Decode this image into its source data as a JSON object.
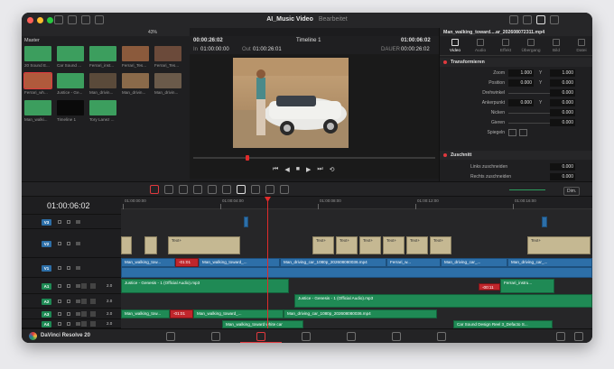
{
  "window": {
    "title": "AI_Music Video",
    "subtitle": "Bearbeitet"
  },
  "colors": {
    "close": "#ff5f57",
    "minimize": "#febc2e",
    "maximize": "#28c840",
    "playhead": "#e02b2b",
    "video_clip": "#2d6fa8",
    "title_clip": "#c5b892",
    "audio_clip": "#1f8a55",
    "red_marker": "#c0262c"
  },
  "media_pool": {
    "header": "Master",
    "zoom": "43%",
    "items": [
      {
        "label": "20 Sound E...",
        "color": "#3c9e5e"
      },
      {
        "label": "Car Sound ...",
        "color": "#3c9e5e"
      },
      {
        "label": "Ferrari_inst...",
        "color": "#3c9e5e"
      },
      {
        "label": "Ferrari_Tes...",
        "color": "#8b5a3c"
      },
      {
        "label": "Ferrari_Tes...",
        "color": "#6b4a3a"
      },
      {
        "label": "Ferrari_wh...",
        "color": "#b05a3c"
      },
      {
        "label": "Justice - Ge...",
        "color": "#3c9e5e"
      },
      {
        "label": "Man_drivin...",
        "color": "#5a4a3a"
      },
      {
        "label": "Man_drivin...",
        "color": "#8a6a4a"
      },
      {
        "label": "Man_drivin...",
        "color": "#6a5a4a"
      },
      {
        "label": "Man_walki...",
        "color": "#3c9e5e"
      },
      {
        "label": "Timeline 1",
        "color": "#0a0a0a"
      },
      {
        "label": "Tory Lanez ...",
        "color": "#3c9e5e"
      }
    ]
  },
  "viewer": {
    "timecode_left": "00:00:26:02",
    "timeline_name": "Timeline 1",
    "timecode_right": "01:00:06:02",
    "in_label": "In",
    "in_tc": "01:00:00:00",
    "out_label": "Out",
    "out_tc": "01:00:26:01",
    "duration_label": "DAUER",
    "duration_tc": "00:00:26:02"
  },
  "inspector": {
    "clip_name": "Man_walking_toward....ar_202608072311.mp4",
    "tabs": [
      "Video",
      "Audio",
      "Effekt",
      "Übergang",
      "Bild",
      "Datei"
    ],
    "section_transform": "Transformieren",
    "zoom_label": "Zoom",
    "zoom_x": "1.000",
    "zoom_y": "1.000",
    "position_label": "Position",
    "pos_x": "0.000",
    "pos_y": "0.000",
    "rotation_label": "Drehwinkel",
    "rotation": "0.000",
    "anchor_label": "Ankerpunkt",
    "anchor_x": "0.000",
    "anchor_y": "0.000",
    "pitch_label": "Nicken",
    "pitch": "0.000",
    "yaw_label": "Gieren",
    "yaw": "0.000",
    "flip_label": "Spiegeln",
    "section_crop": "Zuschnitt",
    "crop_left_label": "Links zuschneiden",
    "crop_left": "0.000",
    "crop_right_label": "Rechts zuschneiden",
    "crop_right": "0.000"
  },
  "timeline": {
    "current_tc": "01:00:06:02",
    "ruler": [
      "01:00:00:00",
      "01:00:04:00",
      "01:00:08:00",
      "01:00:12:00",
      "01:00:16:00"
    ],
    "dim_label": "Dim.",
    "tracks": {
      "v3": "V3",
      "v2": "V2",
      "v1": "V1",
      "a1": "A1",
      "a2": "A2",
      "a3": "A3",
      "a4": "A4",
      "level": "2.0"
    },
    "clips": {
      "text": "Text+",
      "walk1": "Man_walking_tow...",
      "walk2": "Man_walking_toward_...",
      "red1": "-01:01",
      "drive1": "Man_driving_car_1080p_202608080036.mp4",
      "ferrari1": "Ferrari_w...",
      "drive2": "Man_driving_car_...",
      "drive3": "Man_driving_car_...",
      "justice1": "Justice - Genesis - 1 (Official Audio).mp3",
      "red2": "-00:11",
      "ferrari_instr": "Ferrari_instru...",
      "justice2": "Justice - Genesis - 1 (Official Audio).mp3",
      "walk3": "Man_walking_tow...",
      "red3": "-01:01",
      "walk4": "Man_walking_toward_...",
      "drive4": "Man_driving_car_1080p_202608080036.mp4",
      "walk5": "Man_walking_toward white car",
      "carsound": "Car Sound Design Reel 3_Defacto S..."
    }
  },
  "footer": {
    "app_name": "DaVinci Resolve 20"
  }
}
